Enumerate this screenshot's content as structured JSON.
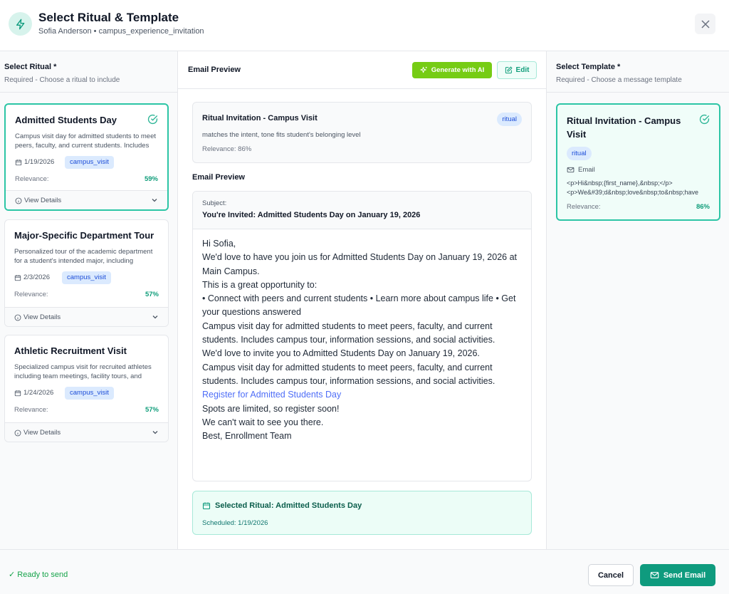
{
  "header": {
    "title": "Select Ritual & Template",
    "subtitle": "Sofia Anderson • campus_experience_invitation",
    "icon": "lightning-icon"
  },
  "ritual_panel": {
    "title": "Select Ritual *",
    "subtitle": "Required - Choose a ritual to include",
    "rituals": [
      {
        "name": "Admitted Students Day",
        "description": "Campus visit day for admitted students to meet peers, faculty, and current students. Includes campus tour, information sessions, and social activities.",
        "date": "1/19/2026",
        "tag": "campus_visit",
        "relevance_label": "Relevance:",
        "relevance": "59%",
        "details_label": "View Details",
        "selected": true
      },
      {
        "name": "Major-Specific Department Tour",
        "description": "Personalized tour of the academic department for a student's intended major, including meetings with faculty.",
        "date": "2/3/2026",
        "tag": "campus_visit",
        "relevance_label": "Relevance:",
        "relevance": "57%",
        "details_label": "View Details",
        "selected": false
      },
      {
        "name": "Athletic Recruitment Visit",
        "description": "Specialized campus visit for recruited athletes including team meetings, facility tours, and coach meetings.",
        "date": "1/24/2026",
        "tag": "campus_visit",
        "relevance_label": "Relevance:",
        "relevance": "57%",
        "details_label": "View Details",
        "selected": false
      }
    ]
  },
  "preview_panel": {
    "title": "Email Preview",
    "generate_ai_label": "Generate with AI",
    "edit_label": "Edit",
    "template_summary": {
      "name": "Ritual Invitation - Campus Visit",
      "badge": "ritual",
      "reason": "matches the intent, tone fits student's belonging level",
      "relevance": "Relevance: 86%"
    },
    "email_preview_label": "Email Preview",
    "subject_label": "Subject:",
    "subject": "You're Invited: Admitted Students Day on January 19, 2026",
    "body": {
      "greeting": "Hi Sofia,",
      "line1": "We'd love to have you join us for Admitted Students Day on January 19, 2026 at Main Campus.",
      "line2": "This is a great opportunity to:",
      "line3": "• Connect with peers and current students • Learn more about campus life • Get your questions answered",
      "line4": "Campus visit day for admitted students to meet peers, faculty, and current students. Includes campus tour, information sessions, and social activities.",
      "line5": "We'd love to invite you to Admitted Students Day on January 19, 2026.",
      "line6": "Campus visit day for admitted students to meet peers, faculty, and current students. Includes campus tour, information sessions, and social activities.",
      "link": "Register for Admitted Students Day",
      "line7": "Spots are limited, so register soon!",
      "line8": "We can't wait to see you there.",
      "signoff": "Best, Enrollment Team"
    },
    "selected_ritual": {
      "title": "Selected Ritual: Admitted Students Day",
      "scheduled": "Scheduled: 1/19/2026"
    }
  },
  "template_panel": {
    "title": "Select Template *",
    "subtitle": "Required - Choose a message template",
    "templates": [
      {
        "name": "Ritual Invitation - Campus Visit",
        "badge": "ritual",
        "channel": "Email",
        "html_line1": "<p>Hi&nbsp;{first_name},&nbsp;</p>",
        "html_line2": "<p>We&#39;d&nbsp;love&nbsp;to&nbsp;have",
        "relevance_label": "Relevance:",
        "relevance": "86%",
        "selected": true
      }
    ]
  },
  "footer": {
    "status": "✓ Ready to send",
    "cancel_label": "Cancel",
    "send_label": "Send Email"
  },
  "colors": {
    "accent": "#0f9b7e",
    "selected_border": "#2cc5a5",
    "ai_button": "#76cc14",
    "link": "#4f6ef7",
    "tag_bg": "#dbeafe"
  }
}
